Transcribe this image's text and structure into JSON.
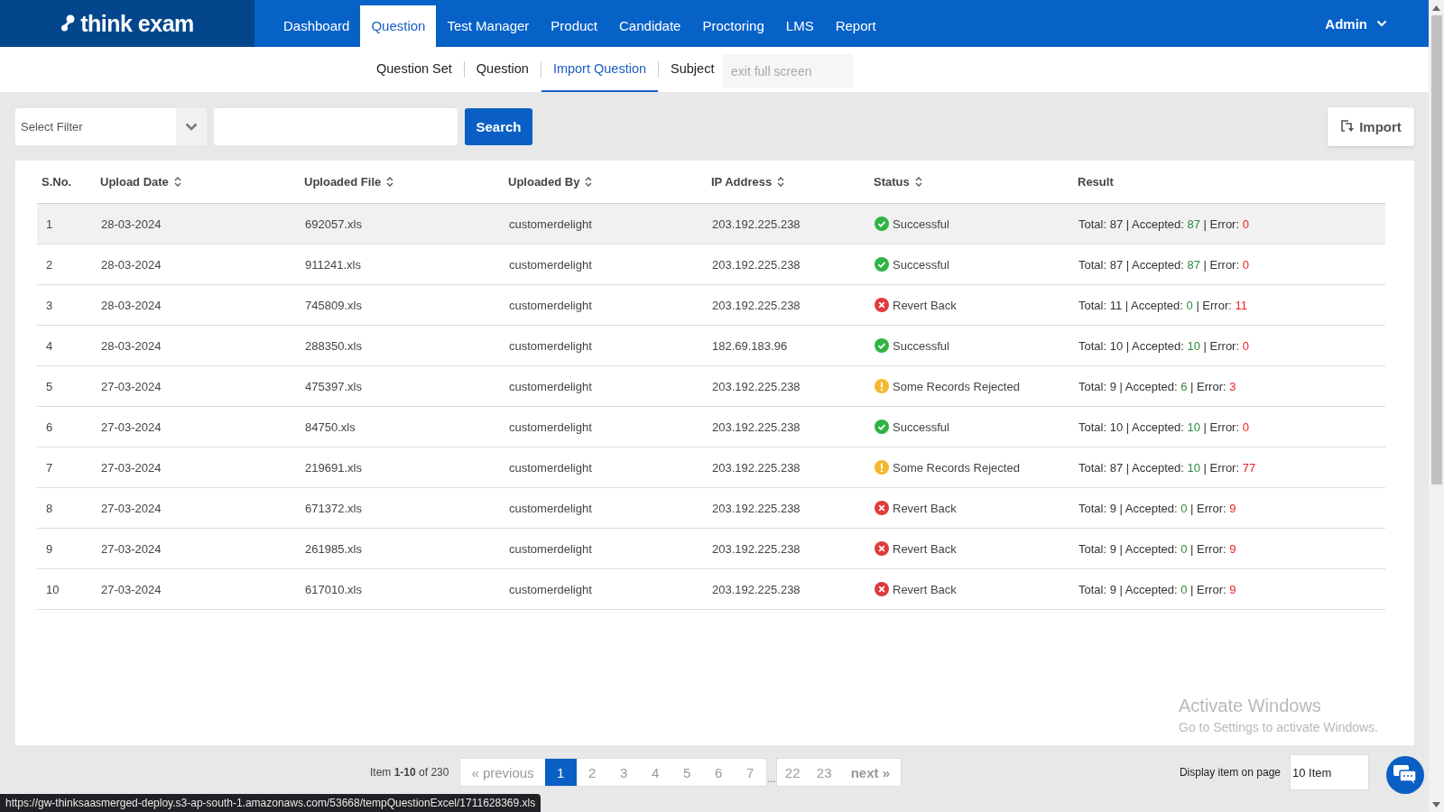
{
  "brand": {
    "name": "think exam"
  },
  "nav": [
    {
      "label": "Dashboard",
      "selected": false
    },
    {
      "label": "Question",
      "selected": true
    },
    {
      "label": "Test Manager",
      "selected": false
    },
    {
      "label": "Product",
      "selected": false
    },
    {
      "label": "Candidate",
      "selected": false
    },
    {
      "label": "Proctoring",
      "selected": false
    },
    {
      "label": "LMS",
      "selected": false
    },
    {
      "label": "Report",
      "selected": false
    }
  ],
  "user": {
    "name": "Admin"
  },
  "subnav": [
    {
      "label": "Question Set",
      "selected": false
    },
    {
      "label": "Question",
      "selected": false
    },
    {
      "label": "Import Question",
      "selected": true
    },
    {
      "label": "Subject",
      "selected": false
    }
  ],
  "fullscreen_hint": "exit full screen",
  "filter": {
    "placeholder": "Select Filter"
  },
  "search_button": "Search",
  "import_button": "Import",
  "table": {
    "columns": [
      {
        "label": "S.No.",
        "sortable": false
      },
      {
        "label": "Upload Date",
        "sortable": true
      },
      {
        "label": "Uploaded File",
        "sortable": true
      },
      {
        "label": "Uploaded By",
        "sortable": true
      },
      {
        "label": "IP Address",
        "sortable": true
      },
      {
        "label": "Status",
        "sortable": true
      },
      {
        "label": "Result",
        "sortable": false
      }
    ],
    "rows": [
      {
        "sno": "1",
        "date": "28-03-2024",
        "file": "692057.xls",
        "by": "customerdelight",
        "ip": "203.192.225.238",
        "status": {
          "kind": "success",
          "label": "Successful"
        },
        "result": [
          {
            "kind": "plain",
            "text": "Total: 87 | Accepted:"
          },
          {
            "kind": "accepted",
            "text": "87"
          },
          {
            "kind": "plain",
            "text": "| Error:"
          },
          {
            "kind": "error",
            "text": "0"
          }
        ],
        "selected": true
      },
      {
        "sno": "2",
        "date": "28-03-2024",
        "file": "911241.xls",
        "by": "customerdelight",
        "ip": "203.192.225.238",
        "status": {
          "kind": "success",
          "label": "Successful"
        },
        "result": [
          {
            "kind": "plain",
            "text": "Total: 87 | Accepted:"
          },
          {
            "kind": "accepted",
            "text": "87"
          },
          {
            "kind": "plain",
            "text": "| Error:"
          },
          {
            "kind": "error",
            "text": "0"
          }
        ],
        "selected": false
      },
      {
        "sno": "3",
        "date": "28-03-2024",
        "file": "745809.xls",
        "by": "customerdelight",
        "ip": "203.192.225.238",
        "status": {
          "kind": "reverted",
          "label": "Revert Back"
        },
        "result": [
          {
            "kind": "plain",
            "text": "Total: 11 | Accepted:"
          },
          {
            "kind": "accepted",
            "text": "0"
          },
          {
            "kind": "plain",
            "text": "| Error:"
          },
          {
            "kind": "error",
            "text": "11"
          }
        ],
        "selected": false
      },
      {
        "sno": "4",
        "date": "28-03-2024",
        "file": "288350.xls",
        "by": "customerdelight",
        "ip": "182.69.183.96",
        "status": {
          "kind": "success",
          "label": "Successful"
        },
        "result": [
          {
            "kind": "plain",
            "text": "Total: 10 | Accepted:"
          },
          {
            "kind": "accepted",
            "text": "10"
          },
          {
            "kind": "plain",
            "text": "| Error:"
          },
          {
            "kind": "error",
            "text": "0"
          }
        ],
        "selected": false
      },
      {
        "sno": "5",
        "date": "27-03-2024",
        "file": "475397.xls",
        "by": "customerdelight",
        "ip": "203.192.225.238",
        "status": {
          "kind": "partial",
          "label": "Some Records Rejected"
        },
        "result": [
          {
            "kind": "plain",
            "text": "Total: 9 | Accepted:"
          },
          {
            "kind": "accepted",
            "text": "6"
          },
          {
            "kind": "plain",
            "text": "| Error:"
          },
          {
            "kind": "error",
            "text": "3"
          }
        ],
        "selected": false
      },
      {
        "sno": "6",
        "date": "27-03-2024",
        "file": "84750.xls",
        "by": "customerdelight",
        "ip": "203.192.225.238",
        "status": {
          "kind": "success",
          "label": "Successful"
        },
        "result": [
          {
            "kind": "plain",
            "text": "Total: 10 | Accepted:"
          },
          {
            "kind": "accepted",
            "text": "10"
          },
          {
            "kind": "plain",
            "text": "| Error:"
          },
          {
            "kind": "error",
            "text": "0"
          }
        ],
        "selected": false
      },
      {
        "sno": "7",
        "date": "27-03-2024",
        "file": "219691.xls",
        "by": "customerdelight",
        "ip": "203.192.225.238",
        "status": {
          "kind": "partial",
          "label": "Some Records Rejected"
        },
        "result": [
          {
            "kind": "plain",
            "text": "Total: 87 | Accepted:"
          },
          {
            "kind": "accepted",
            "text": "10"
          },
          {
            "kind": "plain",
            "text": "| Error:"
          },
          {
            "kind": "error",
            "text": "77"
          }
        ],
        "selected": false
      },
      {
        "sno": "8",
        "date": "27-03-2024",
        "file": "671372.xls",
        "by": "customerdelight",
        "ip": "203.192.225.238",
        "status": {
          "kind": "reverted",
          "label": "Revert Back"
        },
        "result": [
          {
            "kind": "plain",
            "text": "Total: 9 | Accepted:"
          },
          {
            "kind": "accepted",
            "text": "0"
          },
          {
            "kind": "plain",
            "text": "| Error:"
          },
          {
            "kind": "error",
            "text": "9"
          }
        ],
        "selected": false
      },
      {
        "sno": "9",
        "date": "27-03-2024",
        "file": "261985.xls",
        "by": "customerdelight",
        "ip": "203.192.225.238",
        "status": {
          "kind": "reverted",
          "label": "Revert Back"
        },
        "result": [
          {
            "kind": "plain",
            "text": "Total: 9 | Accepted:"
          },
          {
            "kind": "accepted",
            "text": "0"
          },
          {
            "kind": "plain",
            "text": "| Error:"
          },
          {
            "kind": "error",
            "text": "9"
          }
        ],
        "selected": false
      },
      {
        "sno": "10",
        "date": "27-03-2024",
        "file": "617010.xls",
        "by": "customerdelight",
        "ip": "203.192.225.238",
        "status": {
          "kind": "reverted",
          "label": "Revert Back"
        },
        "result": [
          {
            "kind": "plain",
            "text": "Total: 9 | Accepted:"
          },
          {
            "kind": "accepted",
            "text": "0"
          },
          {
            "kind": "plain",
            "text": "| Error:"
          },
          {
            "kind": "error",
            "text": "9"
          }
        ],
        "selected": false
      }
    ]
  },
  "windows_notice": {
    "title": "Activate Windows",
    "text": "Go to Settings to activate Windows."
  },
  "pagination": {
    "summary": "Item **1-10** of 230",
    "previous": "« previous",
    "next": "next »",
    "ellipsis": "...",
    "pages": [
      {
        "label": "1",
        "selected": true
      },
      {
        "label": "2",
        "selected": false
      },
      {
        "label": "3",
        "selected": false
      },
      {
        "label": "4",
        "selected": false
      },
      {
        "label": "5",
        "selected": false
      },
      {
        "label": "6",
        "selected": false
      },
      {
        "label": "7",
        "selected": false
      }
    ],
    "tail_pages": [
      {
        "label": "22",
        "selected": false
      },
      {
        "label": "23",
        "selected": false
      }
    ]
  },
  "page_size": {
    "label": "Display item on page",
    "value": "10 Item"
  },
  "status_url": "https://gw-thinksaasmerged-deploy.s3-ap-south-1.amazonaws.com/53668/tempQuestionExcel/1711628369.xls"
}
